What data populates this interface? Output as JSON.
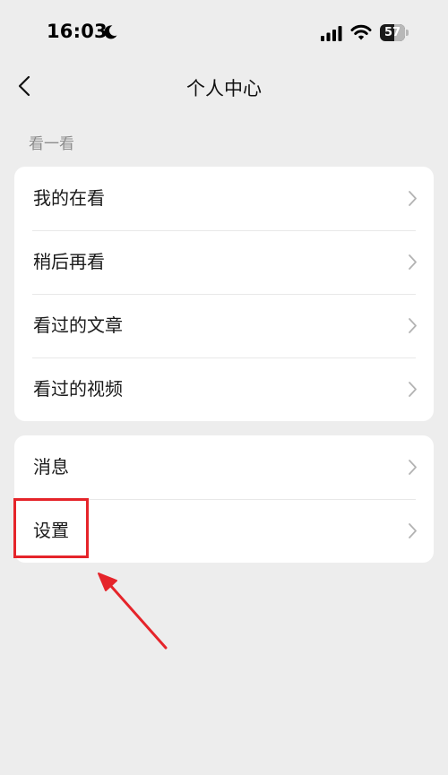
{
  "status_bar": {
    "time": "16:03",
    "battery": "57",
    "icons": [
      "moon-icon",
      "signal-icon",
      "wifi-icon",
      "battery-icon"
    ]
  },
  "nav": {
    "title": "个人中心",
    "back_icon": "chevron-left-icon"
  },
  "section": {
    "title": "看一看"
  },
  "groups": [
    {
      "items": [
        {
          "label": "我的在看"
        },
        {
          "label": "稍后再看"
        },
        {
          "label": "看过的文章"
        },
        {
          "label": "看过的视频"
        }
      ]
    },
    {
      "items": [
        {
          "label": "消息"
        },
        {
          "label": "设置"
        }
      ]
    }
  ],
  "annotation": {
    "color": "#e5242a",
    "target": "设置"
  },
  "colors": {
    "background": "#ededed",
    "card": "#ffffff",
    "secondary_text": "#8c8c8c",
    "chevron": "#b3b3b3"
  }
}
